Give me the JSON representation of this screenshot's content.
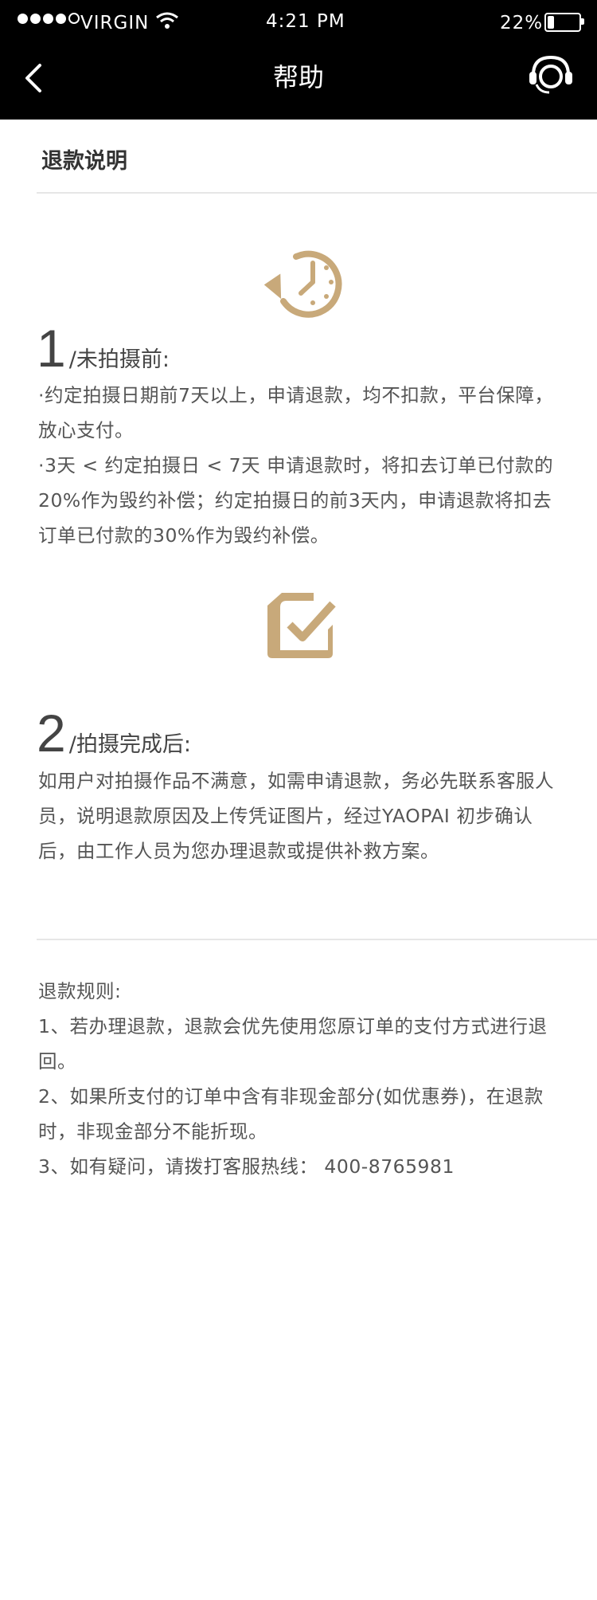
{
  "status_bar": {
    "carrier": "VIRGIN",
    "time": "4:21 PM",
    "battery": "22%",
    "battery_level": 0.22
  },
  "nav": {
    "title": "帮助",
    "back_icon": "chevron-left-icon",
    "service_icon": "customer-service-icon"
  },
  "page": {
    "section_title": "退款说明"
  },
  "steps": [
    {
      "icon": "clock-refund-icon",
      "number": "1",
      "label": "/未拍摄前:",
      "paragraphs": [
        "·约定拍摄日期前7天以上，申请退款，均不扣款，平台保障，放心支付。",
        "·3天 < 约定拍摄日 < 7天 申请退款时，将扣去订单已付款的20%作为毁约补偿；约定拍摄日的前3天内，申请退款将扣去订单已付款的30%作为毁约补偿。"
      ]
    },
    {
      "icon": "checklist-icon",
      "number": "2",
      "label": "/拍摄完成后:",
      "paragraphs": [
        "如用户对拍摄作品不满意，如需申请退款，务必先联系客服人员，说明退款原因及上传凭证图片，经过YAOPAI  初步确认后，由工作人员为您办理退款或提供补救方案。"
      ]
    }
  ],
  "rules": {
    "title": "退款规则:",
    "items": [
      "1、若办理退款，退款会优先使用您原订单的支付方式进行退回。",
      "2、如果所支付的订单中含有非现金部分(如优惠券)，在退款时，非现金部分不能折现。",
      "3、如有疑问，请拨打客服热线：  400-8765981"
    ]
  },
  "colors": {
    "header_bg": "#000000",
    "accent_gold": "#c8a97a",
    "text": "#555555"
  }
}
